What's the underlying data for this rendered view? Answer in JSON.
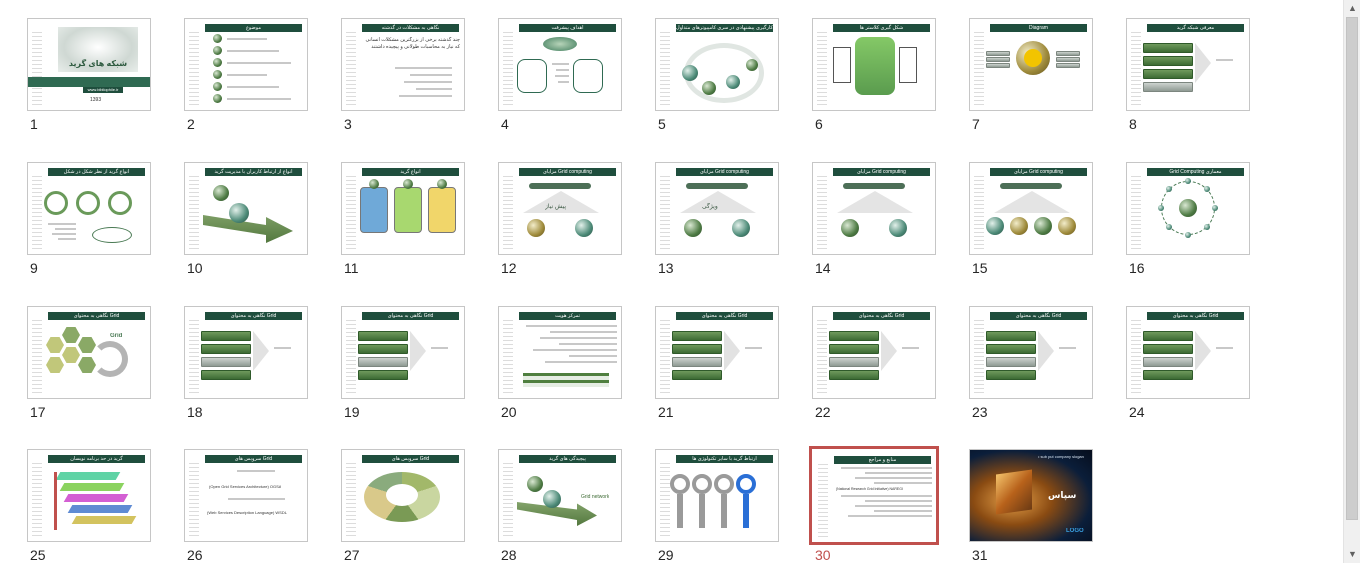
{
  "slide_sorter": {
    "selected": 30,
    "accent_color": "#c0504d",
    "slides": [
      {
        "number": "1",
        "caption": "شبکه های گرید",
        "sub": "www.bibliophile.ir",
        "date": "1393"
      },
      {
        "number": "2",
        "caption": "موضوع"
      },
      {
        "number": "3",
        "caption": "نگاهی به مشکلات در گذشته",
        "body": "چند گذشته برخی از بزرگترین مشکلات انسانی که نیاز به محاسبات طولانی و پیچیده داشتند"
      },
      {
        "number": "4",
        "caption": "اهداف پیشرفت"
      },
      {
        "number": "5",
        "caption": "به‌کارگیری پیشنهادی در سری کامپیوترهای متداول"
      },
      {
        "number": "6",
        "caption": "شکل گیری کلاستر ها"
      },
      {
        "number": "7",
        "caption": "Diagram"
      },
      {
        "number": "8",
        "caption": "معرفی شبکه گرید"
      },
      {
        "number": "9",
        "caption": "انواع گرید از نظر شکل در شکل"
      },
      {
        "number": "10",
        "caption": "انواع از ارتباط کاربران با مدیریت گرید"
      },
      {
        "number": "11",
        "caption": "انواع گرید"
      },
      {
        "number": "12",
        "caption": "مزایای Grid computing",
        "body": "پیش نیاز"
      },
      {
        "number": "13",
        "caption": "مزایای Grid computing",
        "body": "ویژگی"
      },
      {
        "number": "14",
        "caption": "مزایای Grid computing"
      },
      {
        "number": "15",
        "caption": "مزایای Grid computing"
      },
      {
        "number": "16",
        "caption": "Grid Computing معماری"
      },
      {
        "number": "17",
        "caption": "نگاهی به محتوای Grid",
        "body": "Grid"
      },
      {
        "number": "18",
        "caption": "نگاهی به محتوای Grid"
      },
      {
        "number": "19",
        "caption": "نگاهی به محتوای Grid"
      },
      {
        "number": "20",
        "caption": "تمرکز هویت"
      },
      {
        "number": "21",
        "caption": "نگاهی به محتوای Grid"
      },
      {
        "number": "22",
        "caption": "نگاهی به محتوای Grid"
      },
      {
        "number": "23",
        "caption": "نگاهی به محتوای Grid"
      },
      {
        "number": "24",
        "caption": "نگاهی به محتوای Grid"
      },
      {
        "number": "25",
        "caption": "گرید در حد برنامه نویسان"
      },
      {
        "number": "26",
        "caption": "سرویس های Grid",
        "body": "(Open Grid Services Architecture) OGSA",
        "body2": "(Web Services Description Language) WSDL"
      },
      {
        "number": "27",
        "caption": "سرویس های Grid"
      },
      {
        "number": "28",
        "caption": "پیچیدگی های گرید",
        "body": "Grid network"
      },
      {
        "number": "29",
        "caption": "ارتباط گرید با سایر تکنولوژی ها"
      },
      {
        "number": "30",
        "caption": "منابع و مراجع",
        "body": "(National Research Grid Initiative) NAREGI"
      },
      {
        "number": "31",
        "caption": "• sub put company slogan",
        "body": "سپاس",
        "logo": "LOGO"
      }
    ]
  },
  "scrollbar": {
    "up_arrow": "▲",
    "down_arrow": "▼"
  }
}
